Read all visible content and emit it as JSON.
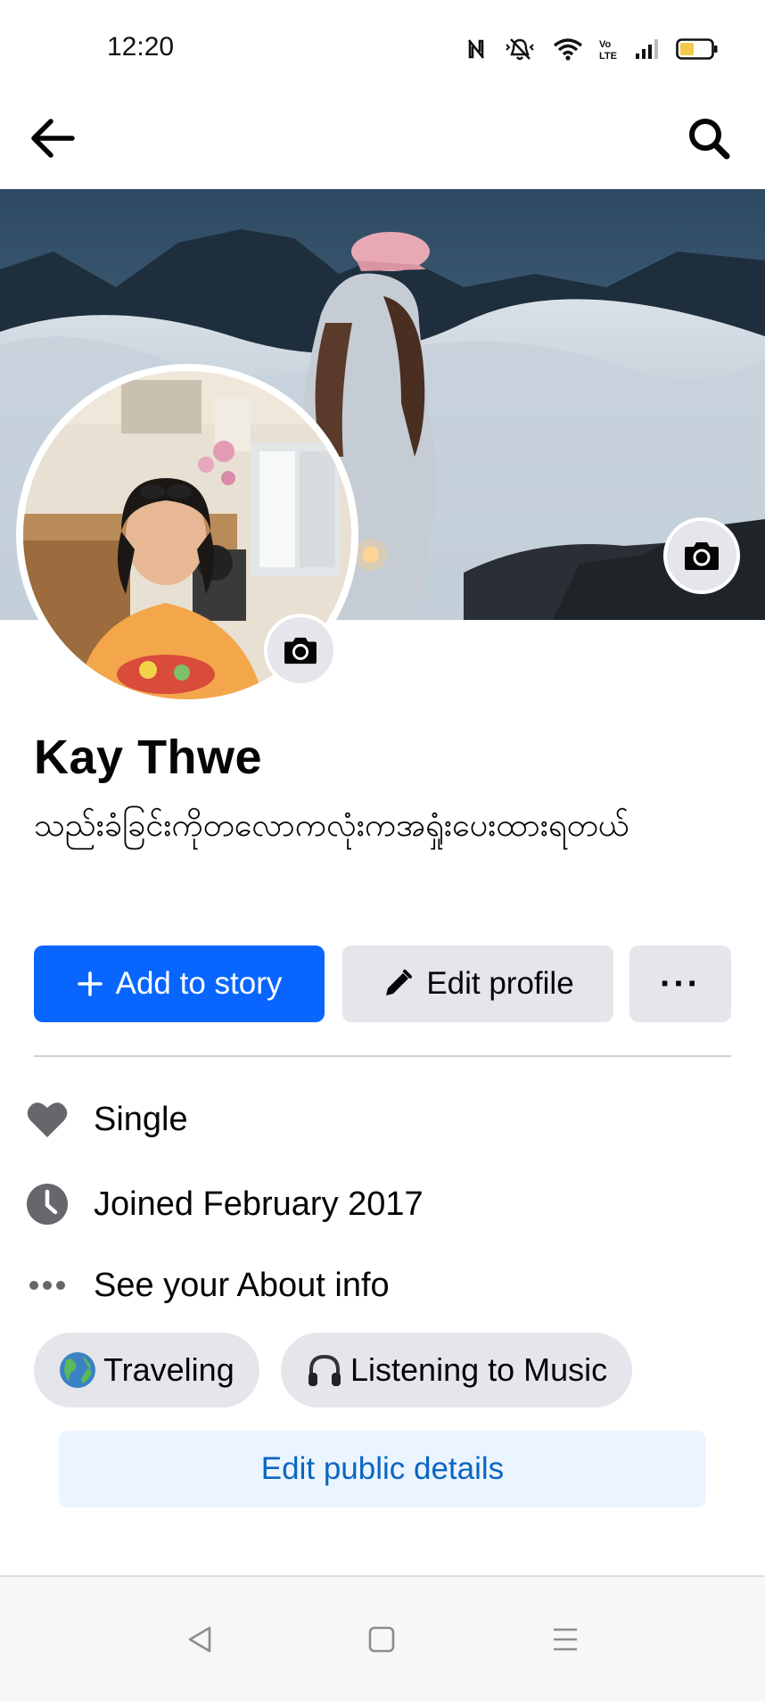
{
  "status_bar": {
    "time": "12:20",
    "icons": [
      "nfc-icon",
      "vibrate-icon",
      "wifi-icon",
      "volte-icon",
      "signal-icon",
      "battery-icon"
    ]
  },
  "app_bar": {
    "back_icon": "arrow-left-icon",
    "search_icon": "search-icon"
  },
  "profile": {
    "name": "Kay Thwe",
    "bio": "သည်းခံခြင်းကိုတလောကလုံးကအရှုံးပေးထားရတယ်"
  },
  "actions": {
    "add_story_label": "Add to story",
    "edit_profile_label": "Edit profile",
    "more_label": "···"
  },
  "info": [
    {
      "icon": "heart-icon",
      "text": "Single"
    },
    {
      "icon": "clock-icon",
      "text": "Joined February 2017"
    },
    {
      "icon": "more-dots-icon",
      "text": "See your About info"
    }
  ],
  "hobbies": [
    {
      "emoji": "🌏",
      "label": "Traveling"
    },
    {
      "emoji": "🎧",
      "label": "Listening to Music"
    }
  ],
  "edit_public_details_label": "Edit public details",
  "colors": {
    "primary": "#0866ff",
    "secondary_button": "#e4e6eb",
    "link_blue": "#0a66c2",
    "light_blue_bg": "#ebf5ff",
    "icon_gray": "#65676b"
  }
}
